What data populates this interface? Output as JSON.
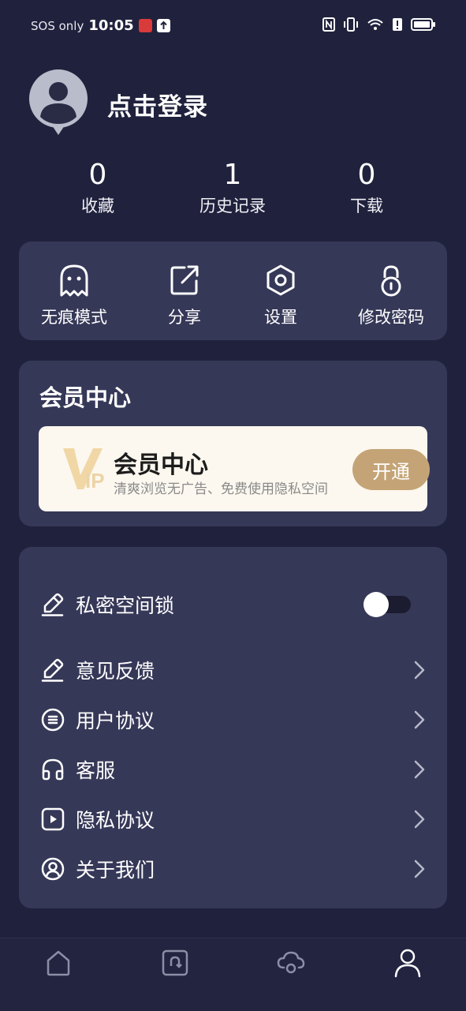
{
  "status_bar": {
    "carrier": "SOS only",
    "time": "10:05"
  },
  "profile": {
    "login_text": "点击登录"
  },
  "stats": [
    {
      "value": "0",
      "label": "收藏"
    },
    {
      "value": "1",
      "label": "历史记录"
    },
    {
      "value": "0",
      "label": "下载"
    }
  ],
  "quick_actions": [
    {
      "label": "无痕模式",
      "icon": "ghost-icon"
    },
    {
      "label": "分享",
      "icon": "share-icon"
    },
    {
      "label": "设置",
      "icon": "settings-hexagon-icon"
    },
    {
      "label": "修改密码",
      "icon": "lock-icon"
    }
  ],
  "vip": {
    "section_title": "会员中心",
    "banner_title": "会员中心",
    "banner_subtitle": "清爽浏览无广告、免费使用隐私空间",
    "logo_text": "VIP",
    "open_label": "开通"
  },
  "menu": {
    "items": [
      {
        "label": "私密空间锁",
        "icon": "pen-icon",
        "control": "toggle",
        "toggle_on": false
      },
      {
        "label": "意见反馈",
        "icon": "pen-icon",
        "control": "chevron"
      },
      {
        "label": "用户协议",
        "icon": "document-circle-icon",
        "control": "chevron"
      },
      {
        "label": "客服",
        "icon": "headset-icon",
        "control": "chevron"
      },
      {
        "label": "隐私协议",
        "icon": "play-square-icon",
        "control": "chevron"
      },
      {
        "label": "关于我们",
        "icon": "user-circle-icon",
        "control": "chevron"
      }
    ]
  },
  "bottom_nav": [
    {
      "name": "home",
      "icon": "home-icon",
      "active": false
    },
    {
      "name": "tabs",
      "icon": "tabs-icon",
      "active": false
    },
    {
      "name": "cloud",
      "icon": "cloud-icon",
      "active": false
    },
    {
      "name": "profile",
      "icon": "person-icon",
      "active": true
    }
  ],
  "colors": {
    "background": "#20223d",
    "card": "#363858",
    "vip_gold": "#c4a476",
    "vip_banner": "#fcf8ef"
  }
}
